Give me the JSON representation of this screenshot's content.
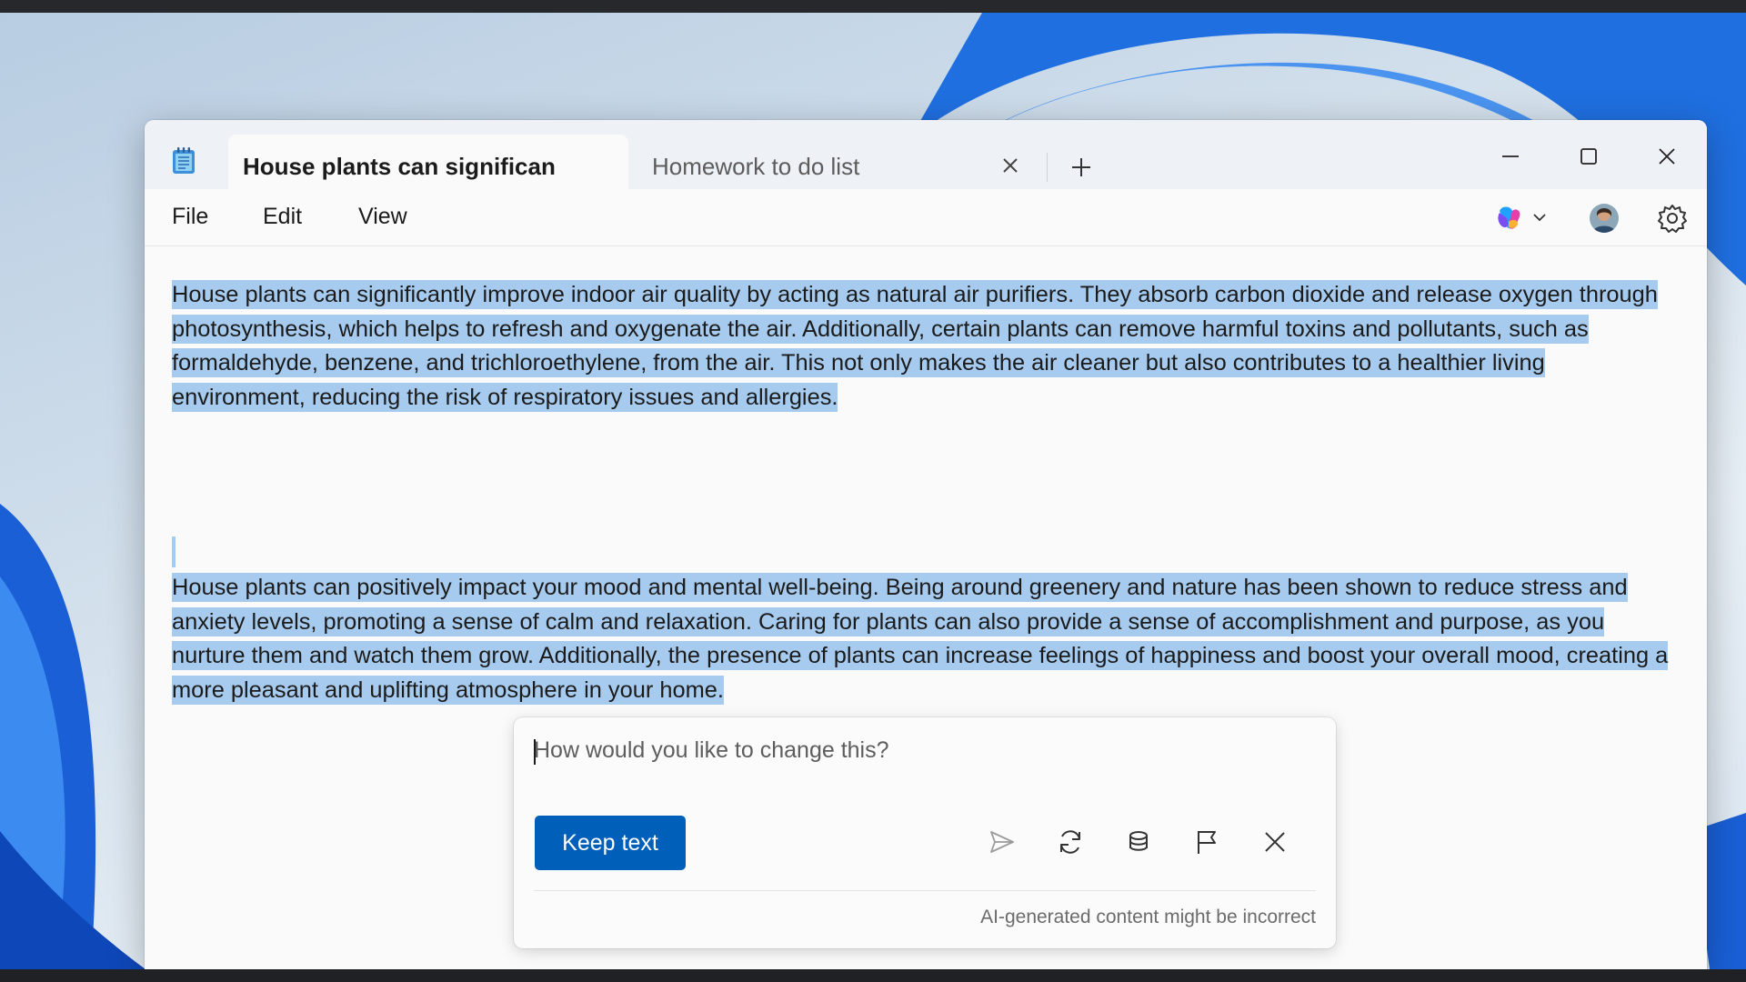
{
  "tabs": [
    {
      "title": "House plants can significan",
      "active": true
    },
    {
      "title": "Homework to do list",
      "active": false
    }
  ],
  "menu": [
    "File",
    "Edit",
    "View"
  ],
  "document": {
    "paragraph1": "House plants can significantly improve indoor air quality by acting as natural air purifiers. They absorb carbon dioxide and release oxygen through photosynthesis, which helps to refresh and oxygenate the air. Additionally, certain plants can remove harmful toxins and pollutants, such as formaldehyde, benzene, and trichloroethylene, from the air. This not only makes the air cleaner but also contributes to a healthier living environment, reducing the risk of respiratory issues and allergies.",
    "paragraph2": "House plants can positively impact your mood and mental well-being. Being around greenery and nature has been shown to reduce stress and anxiety levels, promoting a sense of calm and relaxation. Caring for plants can also provide a sense of accomplishment and purpose, as you nurture them and watch them grow. Additionally, the presence of plants can increase feelings of happiness and boost your overall mood, creating a more pleasant and uplifting atmosphere in your home."
  },
  "rewrite_panel": {
    "placeholder": "How would you like to change this?",
    "keep_button": "Keep text",
    "disclaimer": "AI-generated content might be incorrect"
  },
  "icons": {
    "app": "notepad-icon",
    "copilot": "copilot-icon",
    "settings": "gear-icon",
    "send": "send-icon",
    "regenerate": "refresh-icon",
    "tone": "layers-icon",
    "report": "flag-icon",
    "close": "close-icon"
  },
  "colors": {
    "selection": "#a7cbee",
    "accent": "#005fb8"
  }
}
